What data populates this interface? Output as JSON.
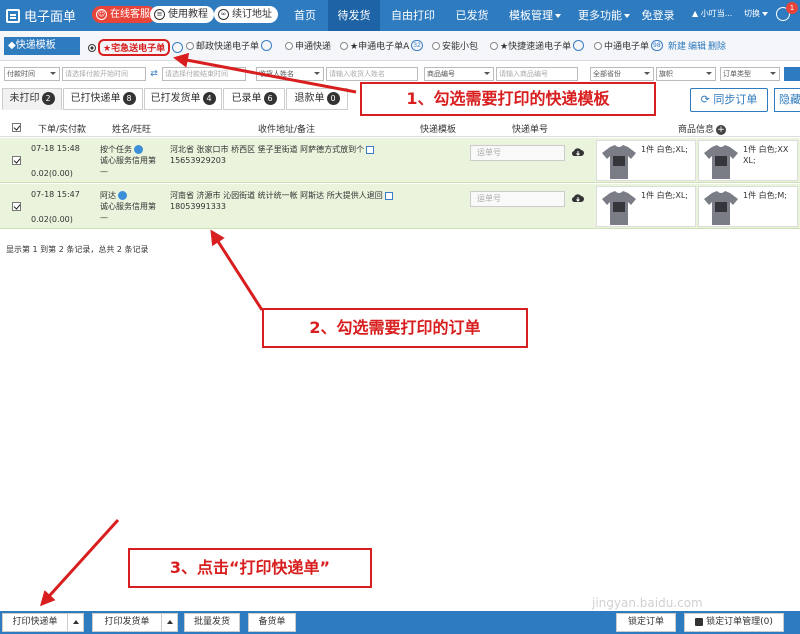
{
  "app": {
    "title": "电子面单"
  },
  "topbar": {
    "service": "在线客服",
    "guide": "使用教程",
    "renew": "续订地址",
    "nav": [
      "首页",
      "待发货",
      "自由打印",
      "已发货",
      "模板管理",
      "更多功能",
      "免登录"
    ],
    "user": "小叮当...",
    "switch": "切换",
    "msg_count": "1"
  },
  "templates": {
    "title": "快递模板",
    "items": [
      {
        "label": "★宅急送电子单",
        "count": "",
        "selected": true
      },
      {
        "label": "邮政快递电子单",
        "count": "",
        "selected": false
      },
      {
        "label": "申通快递",
        "count": "",
        "selected": false
      },
      {
        "label": "★申通电子单A",
        "count": "32",
        "selected": false
      },
      {
        "label": "安能小包",
        "count": "",
        "selected": false
      },
      {
        "label": "★快捷速递电子单",
        "count": "",
        "selected": false
      },
      {
        "label": "中通电子单",
        "count": "98",
        "selected": false
      }
    ],
    "new_link": "新建",
    "edit_link": "编辑",
    "delete_link": "删除"
  },
  "filters": {
    "pay_time": "付款时间",
    "start_ph": "请选择付款开始时间",
    "end_ph": "请选择付款结束时间",
    "receiver": "收货人姓名",
    "receiver_ph": "请输入收货人姓名",
    "product_code": "商品编号",
    "product_ph": "请输入商品编号",
    "province": "全部省份",
    "flag": "旗帜",
    "order_type": "订单类型"
  },
  "tabs": [
    {
      "label": "未打印",
      "count": "2",
      "active": true
    },
    {
      "label": "已打快递单",
      "count": "8",
      "active": false
    },
    {
      "label": "已打发货单",
      "count": "4",
      "active": false
    },
    {
      "label": "已录单",
      "count": "6",
      "active": false
    },
    {
      "label": "退款单",
      "count": "0",
      "active": false
    }
  ],
  "actions": {
    "sync": "同步订单",
    "hide": "隐藏"
  },
  "table": {
    "headers": {
      "order": "下单/实付款",
      "buyer": "姓名/旺旺",
      "address": "收件地址/备注",
      "template": "快递模板",
      "waybill": "快递单号",
      "product": "商品信息"
    },
    "rows": [
      {
        "date": "07-18 15:48",
        "amount": "0.02(0.00)",
        "name": "按个任务",
        "ww": "诚心服务信用第",
        "dash": "—",
        "address": "河北省 张家口市 桥西区 堡子里街道 阿萨德方式放到个",
        "phone": "15653929203",
        "waybill_ph": "运单号",
        "products": [
          {
            "qty": "1件",
            "spec": "白色;XL;"
          },
          {
            "qty": "1件",
            "spec": "白色;XX",
            "spec2": "XL;"
          }
        ]
      },
      {
        "date": "07-18 15:47",
        "amount": "0.02(0.00)",
        "name": "阿达",
        "ww": "诚心服务信用第",
        "dash": "—",
        "address": "河南省 济源市 沁园街道 统计统一帐 阿斯达 所大提供人退回",
        "phone": "18053991333",
        "waybill_ph": "运单号",
        "products": [
          {
            "qty": "1件",
            "spec": "白色;XL;"
          },
          {
            "qty": "1件",
            "spec": "白色;M;"
          }
        ]
      }
    ]
  },
  "summary": "显示第 1 到第 2 条记录，总共 2 条记录",
  "bottom": {
    "print_express": "打印快递单",
    "print_delivery": "打印发货单",
    "batch_ship": "批量发货",
    "stock": "备货单",
    "lock_order": "锁定订单",
    "lock_manage": "锁定订单管理(0)"
  },
  "callouts": {
    "step1": "1、勾选需要打印的快递模板",
    "step2": "2、勾选需要打印的订单",
    "step3": "3、点击“打印快递单”"
  },
  "watermark": "jingyan.baidu.com",
  "colors": {
    "primary": "#2f7bbf",
    "row_bg": "#eaf3dc",
    "callout_red": "#d81e1e"
  }
}
